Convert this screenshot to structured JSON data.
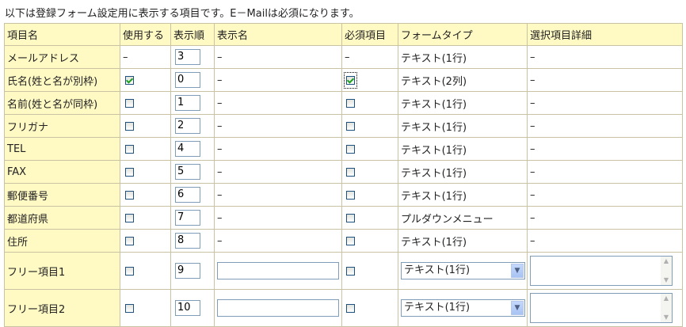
{
  "intro": "以下は登録フォーム設定用に表示する項目です。E－Mailは必須になります。",
  "headers": {
    "item": "項目名",
    "use": "使用する",
    "order": "表示順",
    "label": "表示名",
    "required": "必須項目",
    "type": "フォームタイプ",
    "detail": "選択項目詳細"
  },
  "rows": [
    {
      "name": "メールアドレス",
      "use": "–",
      "order": "3",
      "label": "–",
      "required": "–",
      "type": "テキスト(1行)",
      "detail": "–"
    },
    {
      "name": "氏名(姓と名が別枠)",
      "use": "checked",
      "order": "0",
      "label": "–",
      "required": "checked",
      "type": "テキスト(2列)",
      "detail": "–"
    },
    {
      "name": "名前(姓と名が同枠)",
      "use": "unchecked",
      "order": "1",
      "label": "–",
      "required": "unchecked",
      "type": "テキスト(1行)",
      "detail": "–"
    },
    {
      "name": "フリガナ",
      "use": "unchecked",
      "order": "2",
      "label": "–",
      "required": "unchecked",
      "type": "テキスト(1行)",
      "detail": "–"
    },
    {
      "name": "TEL",
      "use": "unchecked",
      "order": "4",
      "label": "–",
      "required": "unchecked",
      "type": "テキスト(1行)",
      "detail": "–"
    },
    {
      "name": "FAX",
      "use": "unchecked",
      "order": "5",
      "label": "–",
      "required": "unchecked",
      "type": "テキスト(1行)",
      "detail": "–"
    },
    {
      "name": "郵便番号",
      "use": "unchecked",
      "order": "6",
      "label": "–",
      "required": "unchecked",
      "type": "テキスト(1行)",
      "detail": "–"
    },
    {
      "name": "都道府県",
      "use": "unchecked",
      "order": "7",
      "label": "–",
      "required": "unchecked",
      "type": "プルダウンメニュー",
      "detail": "–"
    },
    {
      "name": "住所",
      "use": "unchecked",
      "order": "8",
      "label": "–",
      "required": "unchecked",
      "type": "テキスト(1行)",
      "detail": "–"
    },
    {
      "name": "フリー項目1",
      "use": "unchecked",
      "order": "9",
      "label": "",
      "required": "unchecked",
      "type": "テキスト(1行)",
      "detail": ""
    },
    {
      "name": "フリー項目2",
      "use": "unchecked",
      "order": "10",
      "label": "",
      "required": "unchecked",
      "type": "テキスト(1行)",
      "detail": ""
    }
  ],
  "icons": {
    "checkbox_check_color": "#21a121",
    "select_arrow": "chevron-down-icon",
    "scroll_up": "scroll-up-icon",
    "scroll_down": "scroll-down-icon"
  },
  "colors": {
    "header_bg": "#fff9c4",
    "name_cell_bg": "#fff9c4",
    "border": "#c9c3a3"
  }
}
